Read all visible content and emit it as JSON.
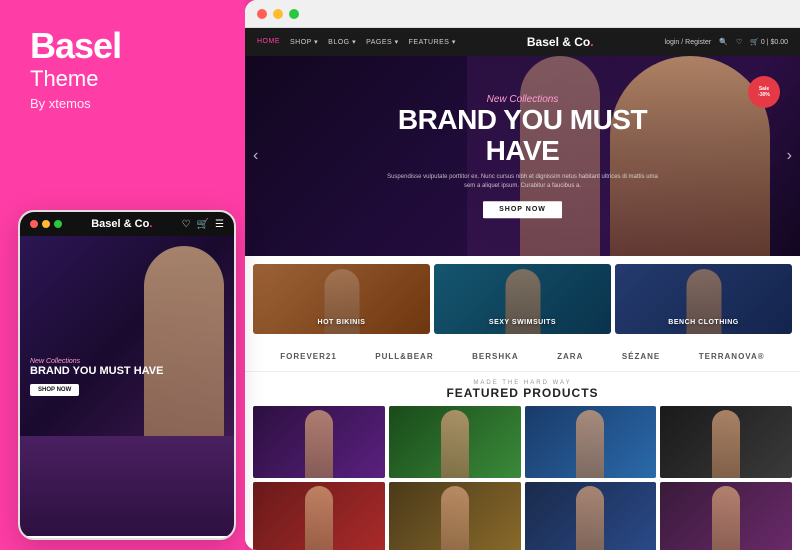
{
  "left": {
    "brand": "Basel",
    "subtitle": "Theme",
    "by": "By xtemos"
  },
  "mobile": {
    "logo": "Basel & Co.",
    "logo_dot_color": "#ff3da6",
    "new_collections": "New Collections",
    "hero_title": "BRAND YOU MUST HAVE",
    "shop_now": "SHOP NOW"
  },
  "desktop": {
    "nav_items": [
      "HOME",
      "SHOP",
      "BLOG",
      "PAGES",
      "FEATURES"
    ],
    "logo": "Basel & Co.",
    "nav_right": [
      "login / Register",
      "🔍",
      "♡",
      "🛒 0 | $0.00"
    ],
    "hero": {
      "new_collections": "New Collections",
      "title": "BRAND YOU MUST HAVE",
      "subtitle": "Suspendisse vulputate porttitor ex. Nunc cursus nibh et dignissim netus habitant ultrices di mattis uma sem a aliquet ipsum. Curabitur a faucibus a.",
      "shop_now": "SHOP NOW",
      "sale_label": "Sale",
      "sale_discount": "-30%"
    },
    "categories": [
      {
        "label": "HOT BIKINIS"
      },
      {
        "label": "SEXY SWIMSUITS"
      },
      {
        "label": "BENCH CLOTHING"
      }
    ],
    "brands": [
      "FOREVER21",
      "PULL&BEAR",
      "Bershka",
      "ZARA",
      "SÉZANE",
      "terranova"
    ],
    "featured": {
      "made_hard": "MADE THE HARD WAY",
      "title": "FEATURED PRODUCTS"
    },
    "products": [
      {
        "id": 1
      },
      {
        "id": 2
      },
      {
        "id": 3
      },
      {
        "id": 4
      },
      {
        "id": 5
      },
      {
        "id": 6
      },
      {
        "id": 7
      },
      {
        "id": 8
      }
    ]
  }
}
